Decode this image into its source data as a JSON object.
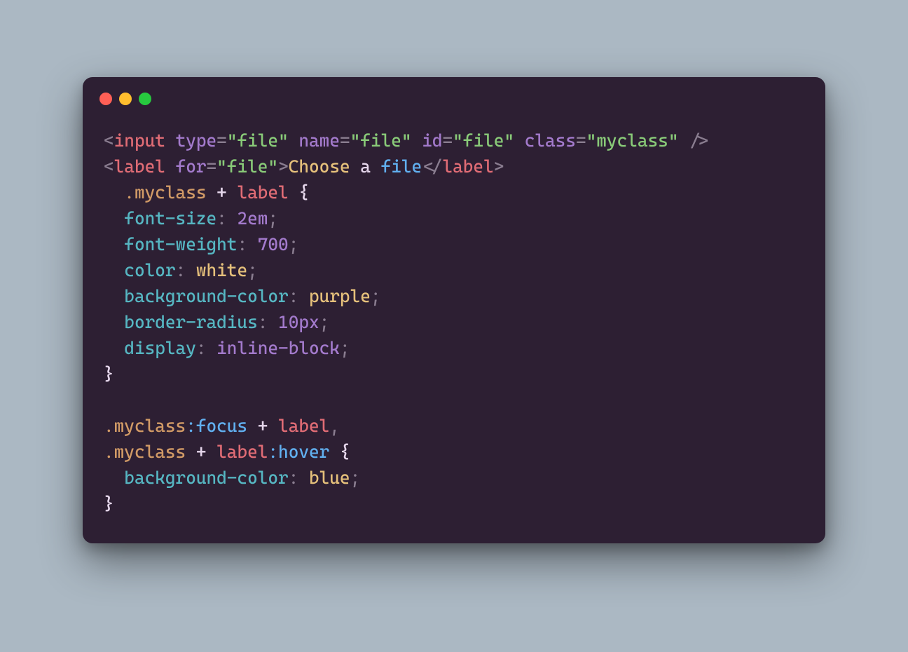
{
  "window": {
    "dots": [
      "red",
      "yellow",
      "green"
    ]
  },
  "html": {
    "input": {
      "tag": "input",
      "attrs": {
        "type_name": "type",
        "type_val": "file",
        "name_name": "name",
        "name_val": "file",
        "id_name": "id",
        "id_val": "file",
        "class_name": "class",
        "class_val": "myclass"
      }
    },
    "label": {
      "tag": "label",
      "for_name": "for",
      "for_val": "file",
      "text_choose": "Choose",
      "text_a": "a",
      "text_file": "file"
    }
  },
  "css": {
    "rule1": {
      "sel_class": ".myclass",
      "combinator": "+",
      "sel_tag": "label",
      "decls": [
        {
          "prop": "font-size",
          "val": "2em",
          "kind": "num"
        },
        {
          "prop": "font-weight",
          "val": "700",
          "kind": "num"
        },
        {
          "prop": "color",
          "val": "white",
          "kind": "kw"
        },
        {
          "prop": "background-color",
          "val": "purple",
          "kind": "kw"
        },
        {
          "prop": "border-radius",
          "val": "10px",
          "kind": "num"
        },
        {
          "prop": "display",
          "val": "inline-block",
          "kind": "num"
        }
      ]
    },
    "rule2": {
      "sel1_class": ".myclass",
      "sel1_pseudo": ":focus",
      "combinator": "+",
      "sel1_tag": "label",
      "sel2_class": ".myclass",
      "sel2_tag": "label",
      "sel2_pseudo": ":hover",
      "decl": {
        "prop": "background-color",
        "val": "blue",
        "kind": "kw"
      }
    }
  }
}
